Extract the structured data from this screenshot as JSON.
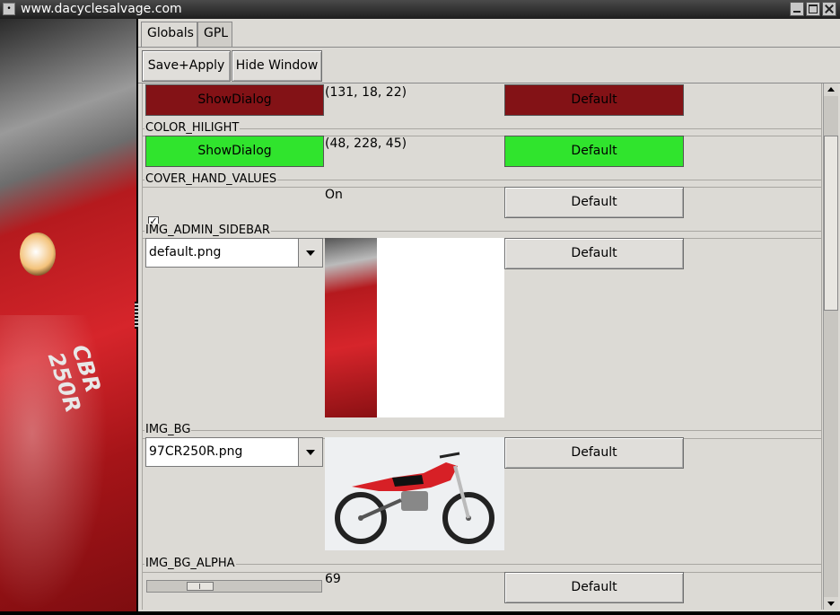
{
  "window": {
    "title": "www.dacyclesalvage.com",
    "menu_glyph": "•"
  },
  "tabs": [
    {
      "label": "Globals",
      "active": true
    },
    {
      "label": "GPL",
      "active": false
    }
  ],
  "toolbar": {
    "save_label": "Save+Apply",
    "hide_label": "Hide Window"
  },
  "settings": {
    "color_top": {
      "button_label": "ShowDialog",
      "value": "(131, 18, 22)",
      "default_label": "Default",
      "color": "#831216"
    },
    "color_hilight": {
      "label": "COLOR_HILIGHT",
      "button_label": "ShowDialog",
      "value": "(48, 228, 45)",
      "default_label": "Default",
      "color": "#30e42d"
    },
    "cover_hand_values": {
      "label": "COVER_HAND_VALUES",
      "checked": true,
      "check_glyph": "✓",
      "value": "On",
      "default_label": "Default"
    },
    "img_admin_sidebar": {
      "label": "IMG_ADMIN_SIDEBAR",
      "selected": "default.png",
      "default_label": "Default"
    },
    "img_bg": {
      "label": "IMG_BG",
      "selected": "97CR250R.png",
      "default_label": "Default"
    },
    "img_bg_alpha": {
      "label": "IMG_BG_ALPHA",
      "value": "69",
      "default_label": "Default",
      "fraction": 0.27
    }
  },
  "sidebar_logo": {
    "line1": "CBR",
    "line2": "250R"
  }
}
